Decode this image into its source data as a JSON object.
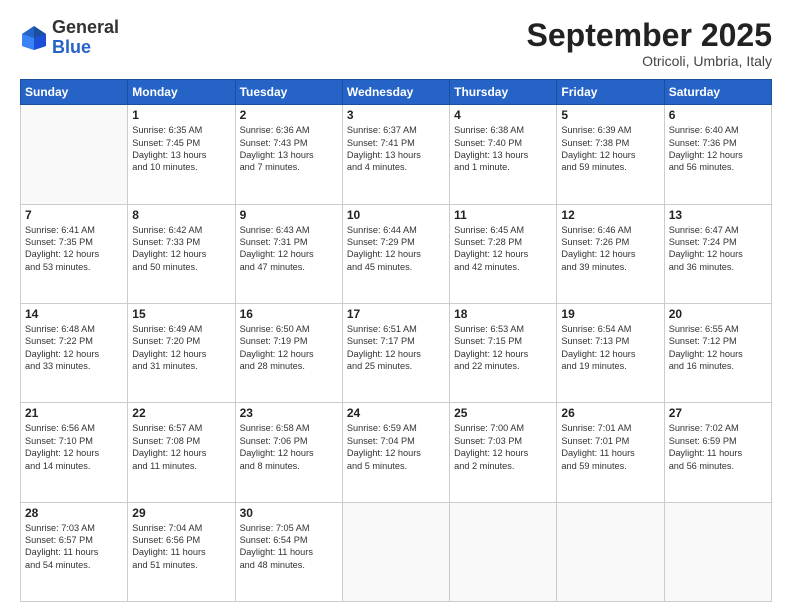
{
  "header": {
    "logo": {
      "general": "General",
      "blue": "Blue"
    },
    "title": "September 2025",
    "location": "Otricoli, Umbria, Italy"
  },
  "columns": [
    "Sunday",
    "Monday",
    "Tuesday",
    "Wednesday",
    "Thursday",
    "Friday",
    "Saturday"
  ],
  "weeks": [
    [
      {
        "day": "",
        "lines": []
      },
      {
        "day": "1",
        "lines": [
          "Sunrise: 6:35 AM",
          "Sunset: 7:45 PM",
          "Daylight: 13 hours",
          "and 10 minutes."
        ]
      },
      {
        "day": "2",
        "lines": [
          "Sunrise: 6:36 AM",
          "Sunset: 7:43 PM",
          "Daylight: 13 hours",
          "and 7 minutes."
        ]
      },
      {
        "day": "3",
        "lines": [
          "Sunrise: 6:37 AM",
          "Sunset: 7:41 PM",
          "Daylight: 13 hours",
          "and 4 minutes."
        ]
      },
      {
        "day": "4",
        "lines": [
          "Sunrise: 6:38 AM",
          "Sunset: 7:40 PM",
          "Daylight: 13 hours",
          "and 1 minute."
        ]
      },
      {
        "day": "5",
        "lines": [
          "Sunrise: 6:39 AM",
          "Sunset: 7:38 PM",
          "Daylight: 12 hours",
          "and 59 minutes."
        ]
      },
      {
        "day": "6",
        "lines": [
          "Sunrise: 6:40 AM",
          "Sunset: 7:36 PM",
          "Daylight: 12 hours",
          "and 56 minutes."
        ]
      }
    ],
    [
      {
        "day": "7",
        "lines": [
          "Sunrise: 6:41 AM",
          "Sunset: 7:35 PM",
          "Daylight: 12 hours",
          "and 53 minutes."
        ]
      },
      {
        "day": "8",
        "lines": [
          "Sunrise: 6:42 AM",
          "Sunset: 7:33 PM",
          "Daylight: 12 hours",
          "and 50 minutes."
        ]
      },
      {
        "day": "9",
        "lines": [
          "Sunrise: 6:43 AM",
          "Sunset: 7:31 PM",
          "Daylight: 12 hours",
          "and 47 minutes."
        ]
      },
      {
        "day": "10",
        "lines": [
          "Sunrise: 6:44 AM",
          "Sunset: 7:29 PM",
          "Daylight: 12 hours",
          "and 45 minutes."
        ]
      },
      {
        "day": "11",
        "lines": [
          "Sunrise: 6:45 AM",
          "Sunset: 7:28 PM",
          "Daylight: 12 hours",
          "and 42 minutes."
        ]
      },
      {
        "day": "12",
        "lines": [
          "Sunrise: 6:46 AM",
          "Sunset: 7:26 PM",
          "Daylight: 12 hours",
          "and 39 minutes."
        ]
      },
      {
        "day": "13",
        "lines": [
          "Sunrise: 6:47 AM",
          "Sunset: 7:24 PM",
          "Daylight: 12 hours",
          "and 36 minutes."
        ]
      }
    ],
    [
      {
        "day": "14",
        "lines": [
          "Sunrise: 6:48 AM",
          "Sunset: 7:22 PM",
          "Daylight: 12 hours",
          "and 33 minutes."
        ]
      },
      {
        "day": "15",
        "lines": [
          "Sunrise: 6:49 AM",
          "Sunset: 7:20 PM",
          "Daylight: 12 hours",
          "and 31 minutes."
        ]
      },
      {
        "day": "16",
        "lines": [
          "Sunrise: 6:50 AM",
          "Sunset: 7:19 PM",
          "Daylight: 12 hours",
          "and 28 minutes."
        ]
      },
      {
        "day": "17",
        "lines": [
          "Sunrise: 6:51 AM",
          "Sunset: 7:17 PM",
          "Daylight: 12 hours",
          "and 25 minutes."
        ]
      },
      {
        "day": "18",
        "lines": [
          "Sunrise: 6:53 AM",
          "Sunset: 7:15 PM",
          "Daylight: 12 hours",
          "and 22 minutes."
        ]
      },
      {
        "day": "19",
        "lines": [
          "Sunrise: 6:54 AM",
          "Sunset: 7:13 PM",
          "Daylight: 12 hours",
          "and 19 minutes."
        ]
      },
      {
        "day": "20",
        "lines": [
          "Sunrise: 6:55 AM",
          "Sunset: 7:12 PM",
          "Daylight: 12 hours",
          "and 16 minutes."
        ]
      }
    ],
    [
      {
        "day": "21",
        "lines": [
          "Sunrise: 6:56 AM",
          "Sunset: 7:10 PM",
          "Daylight: 12 hours",
          "and 14 minutes."
        ]
      },
      {
        "day": "22",
        "lines": [
          "Sunrise: 6:57 AM",
          "Sunset: 7:08 PM",
          "Daylight: 12 hours",
          "and 11 minutes."
        ]
      },
      {
        "day": "23",
        "lines": [
          "Sunrise: 6:58 AM",
          "Sunset: 7:06 PM",
          "Daylight: 12 hours",
          "and 8 minutes."
        ]
      },
      {
        "day": "24",
        "lines": [
          "Sunrise: 6:59 AM",
          "Sunset: 7:04 PM",
          "Daylight: 12 hours",
          "and 5 minutes."
        ]
      },
      {
        "day": "25",
        "lines": [
          "Sunrise: 7:00 AM",
          "Sunset: 7:03 PM",
          "Daylight: 12 hours",
          "and 2 minutes."
        ]
      },
      {
        "day": "26",
        "lines": [
          "Sunrise: 7:01 AM",
          "Sunset: 7:01 PM",
          "Daylight: 11 hours",
          "and 59 minutes."
        ]
      },
      {
        "day": "27",
        "lines": [
          "Sunrise: 7:02 AM",
          "Sunset: 6:59 PM",
          "Daylight: 11 hours",
          "and 56 minutes."
        ]
      }
    ],
    [
      {
        "day": "28",
        "lines": [
          "Sunrise: 7:03 AM",
          "Sunset: 6:57 PM",
          "Daylight: 11 hours",
          "and 54 minutes."
        ]
      },
      {
        "day": "29",
        "lines": [
          "Sunrise: 7:04 AM",
          "Sunset: 6:56 PM",
          "Daylight: 11 hours",
          "and 51 minutes."
        ]
      },
      {
        "day": "30",
        "lines": [
          "Sunrise: 7:05 AM",
          "Sunset: 6:54 PM",
          "Daylight: 11 hours",
          "and 48 minutes."
        ]
      },
      {
        "day": "",
        "lines": []
      },
      {
        "day": "",
        "lines": []
      },
      {
        "day": "",
        "lines": []
      },
      {
        "day": "",
        "lines": []
      }
    ]
  ]
}
